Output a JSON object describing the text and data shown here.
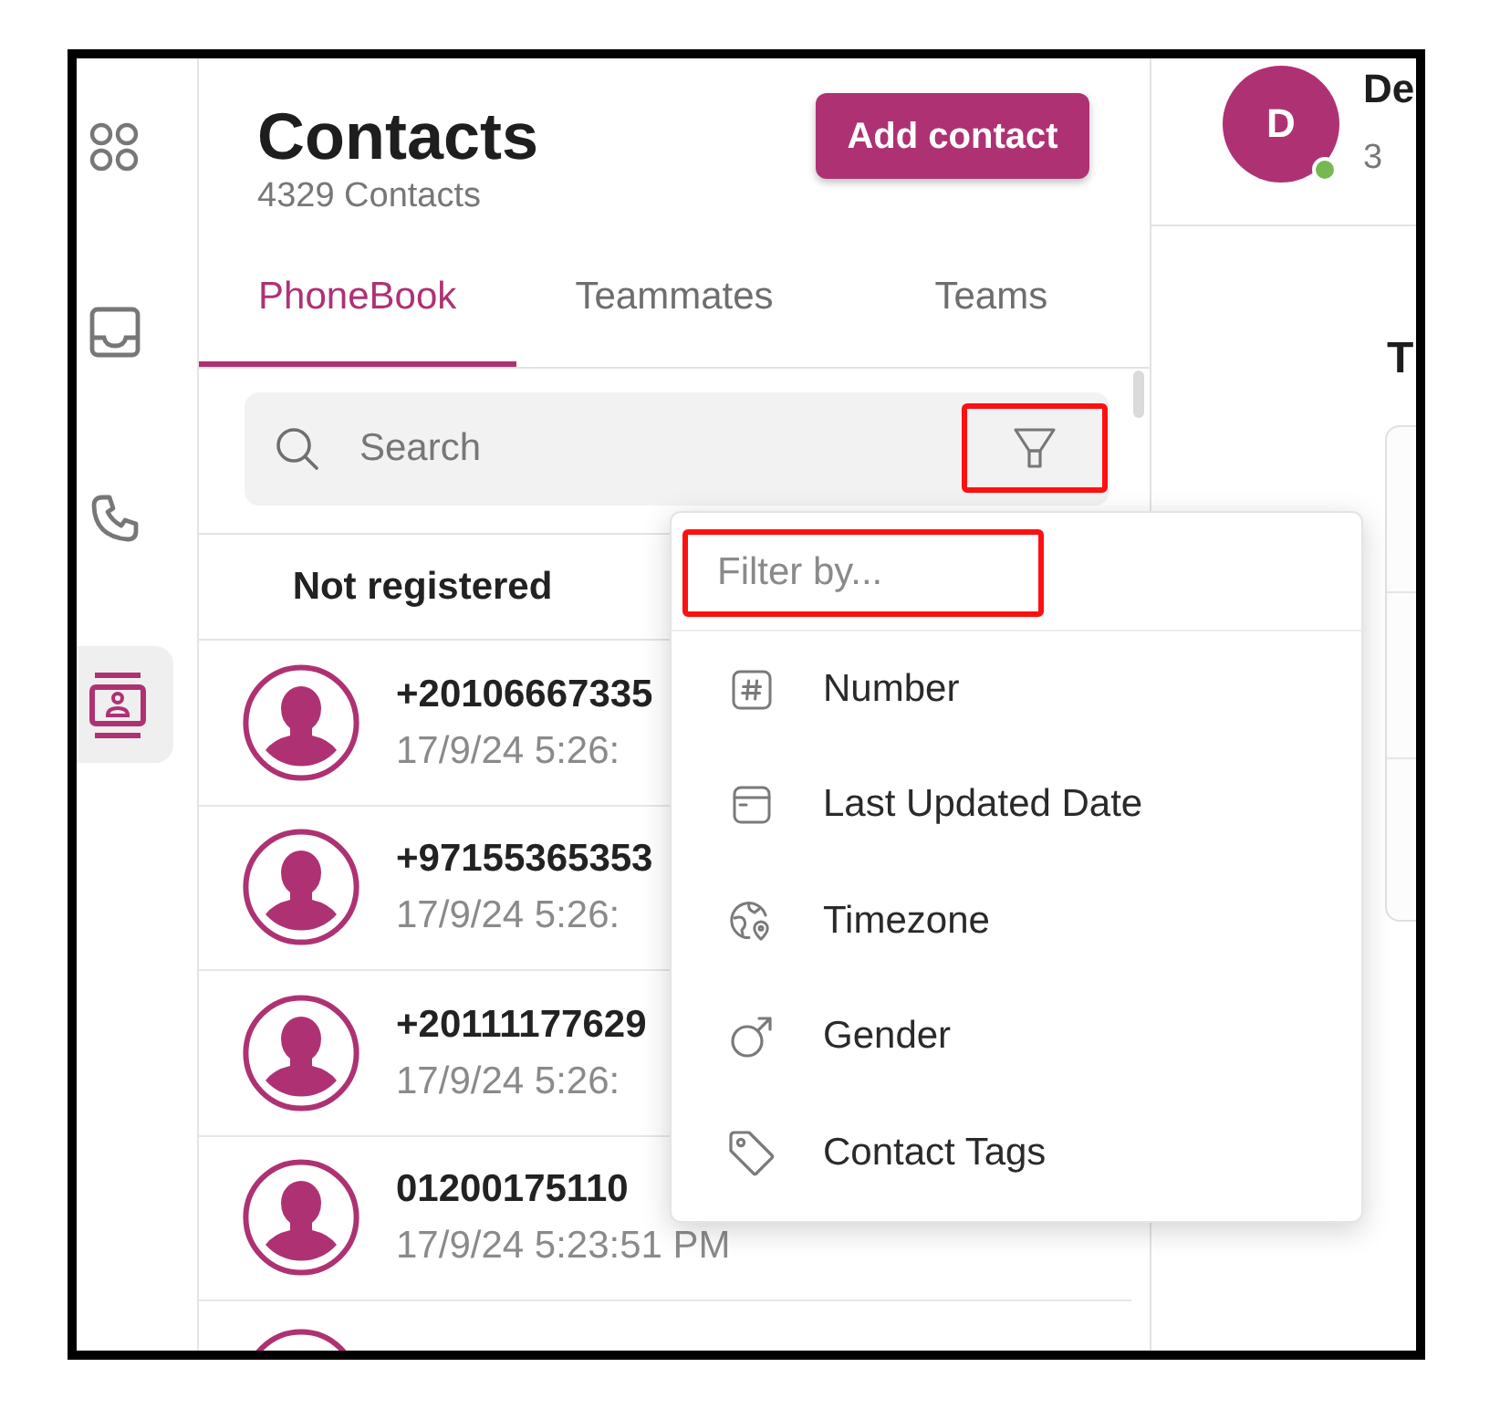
{
  "nav_rail": [
    {
      "selected": false
    },
    {
      "selected": false
    },
    {
      "selected": false
    },
    {
      "selected": true
    }
  ],
  "contacts_panel": {
    "title": "Contacts",
    "count": "4329 Contacts",
    "add_button": "Add contact",
    "tabs": [
      {
        "label": "PhoneBook",
        "selected": true
      },
      {
        "label": "Teammates",
        "selected": false
      },
      {
        "label": "Teams",
        "selected": false
      }
    ],
    "search": {
      "placeholder": "Search"
    },
    "segment": "Not registered",
    "contacts": [
      {
        "number": "+20106667335",
        "updated": "17/9/24 5:26:"
      },
      {
        "number": "+97155365353",
        "updated": "17/9/24 5:26:"
      },
      {
        "number": "+20111177629",
        "updated": "17/9/24 5:26:"
      },
      {
        "number": "01200175110",
        "updated": "17/9/24 5:23:51 PM"
      }
    ]
  },
  "filter_menu": {
    "placeholder": "Filter by...",
    "items": [
      "Number",
      "Last Updated Date",
      "Timezone",
      "Gender",
      "Contact Tags"
    ]
  },
  "detail_panel": {
    "avatar_initial": "D",
    "online": true,
    "name": "De",
    "subtitle": "3",
    "heading": "T"
  }
}
